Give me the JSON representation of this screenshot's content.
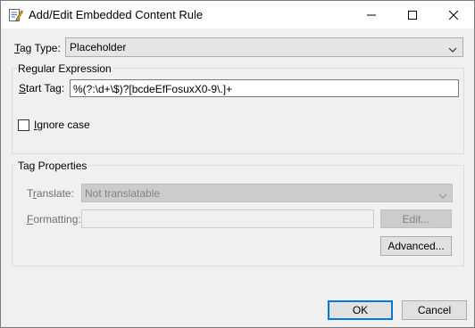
{
  "window": {
    "title": "Add/Edit Embedded Content Rule",
    "minimize_label": "Minimize",
    "maximize_label": "Maximize",
    "close_label": "Close"
  },
  "tag_type": {
    "label": "Tag Type:",
    "value": "Placeholder"
  },
  "regex": {
    "legend": "Regular Expression",
    "start_tag_label": "Start Tag:",
    "start_tag_value": "%(?:\\d+\\$)?[bcdeEfFosuxX0-9\\.]+",
    "ignore_case_label": "Ignore case",
    "ignore_case_checked": false
  },
  "tag_properties": {
    "legend": "Tag Properties",
    "translate_label": "Translate:",
    "translate_value": "Not translatable",
    "formatting_label": "Formatting:",
    "formatting_value": "",
    "edit_button": "Edit...",
    "advanced_button": "Advanced..."
  },
  "footer": {
    "ok_button": "OK",
    "cancel_button": "Cancel"
  },
  "colors": {
    "accent": "#0078d7",
    "window_bg": "#f0f0f0",
    "titlebar_bg": "#ffffff"
  }
}
